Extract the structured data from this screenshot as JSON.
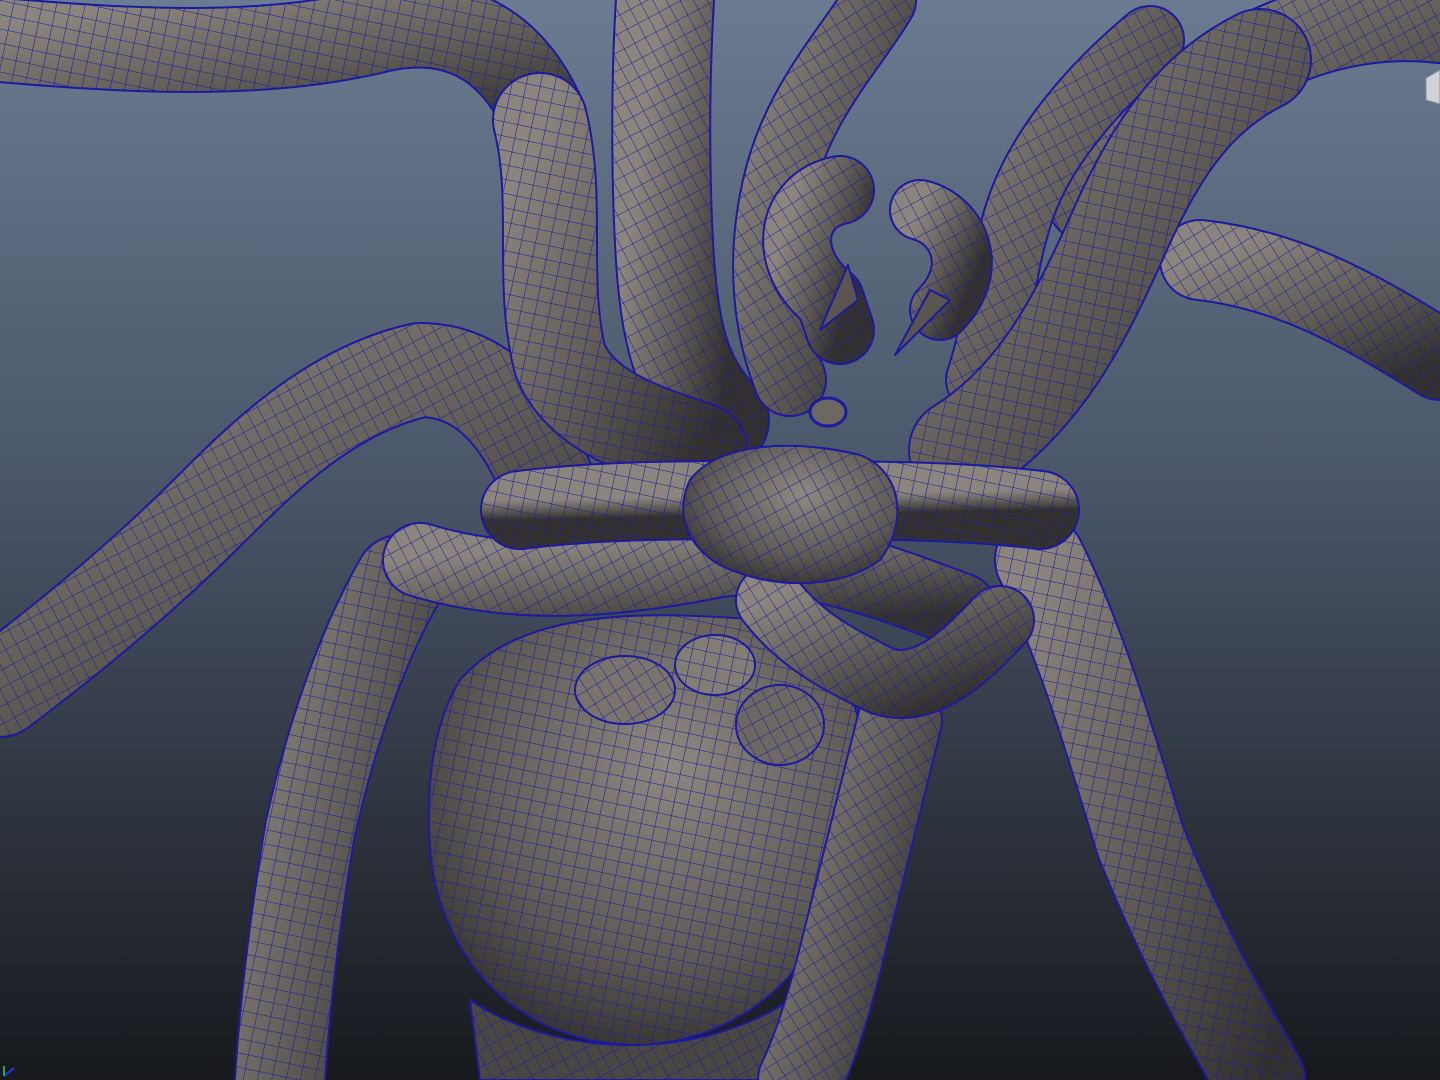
{
  "viewport": {
    "panel": "perspective-viewport",
    "display_mode": "wireframe-on-shaded",
    "background_gradient": {
      "top": "#6b7b91",
      "bottom": "#17191d"
    },
    "mesh_colors": {
      "surface": "#6b6660",
      "surface_dark": "#2e2b29",
      "surface_light": "#a39d95",
      "wireframe": "#1b1aa0"
    },
    "model": "spider-mesh",
    "icons": {
      "axis": "axis-gizmo-icon",
      "view_cube": "view-cube-icon"
    }
  }
}
